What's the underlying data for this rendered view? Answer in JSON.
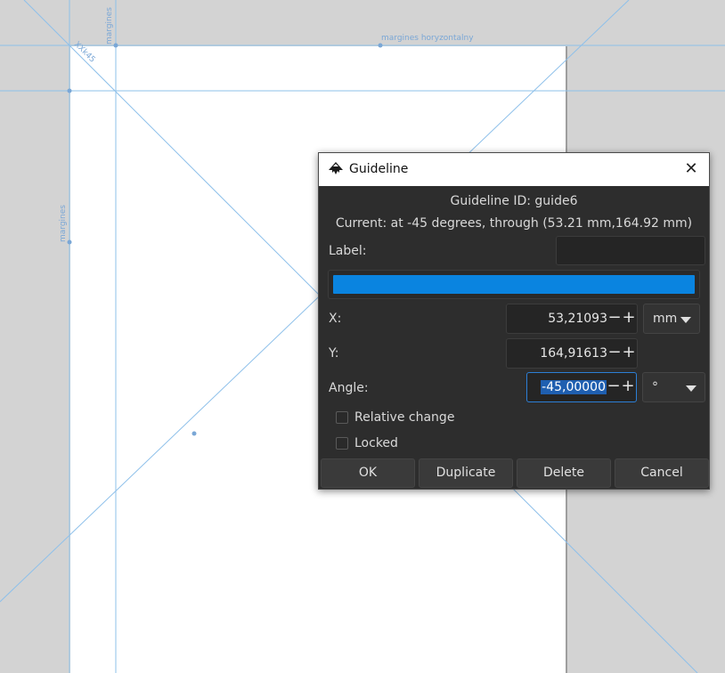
{
  "canvas": {
    "guide_labels": {
      "top_horizontal": "margines horyzontalny",
      "left_vertical_top": "margines",
      "left_vertical_mid": "margines",
      "diagonal": "XXk45"
    }
  },
  "dialog": {
    "title": "Guideline",
    "close_glyph": "✕",
    "guideline_id": "Guideline ID: guide6",
    "current": "Current: at -45 degrees, through (53.21 mm,164.92 mm)",
    "label_field": {
      "label": "Label:",
      "value": ""
    },
    "color": "#0a84e0",
    "x": {
      "label": "X:",
      "value": "53,21093",
      "unit": "mm"
    },
    "y": {
      "label": "Y:",
      "value": "164,91613"
    },
    "angle": {
      "label": "Angle:",
      "value": "-45,00000",
      "unit": "°"
    },
    "relative_change": {
      "label": "Relative change",
      "checked": false
    },
    "locked": {
      "label": "Locked",
      "checked": false
    },
    "buttons": {
      "ok": "OK",
      "duplicate": "Duplicate",
      "delete": "Delete",
      "cancel": "Cancel"
    },
    "spin_minus": "−",
    "spin_plus": "+"
  }
}
